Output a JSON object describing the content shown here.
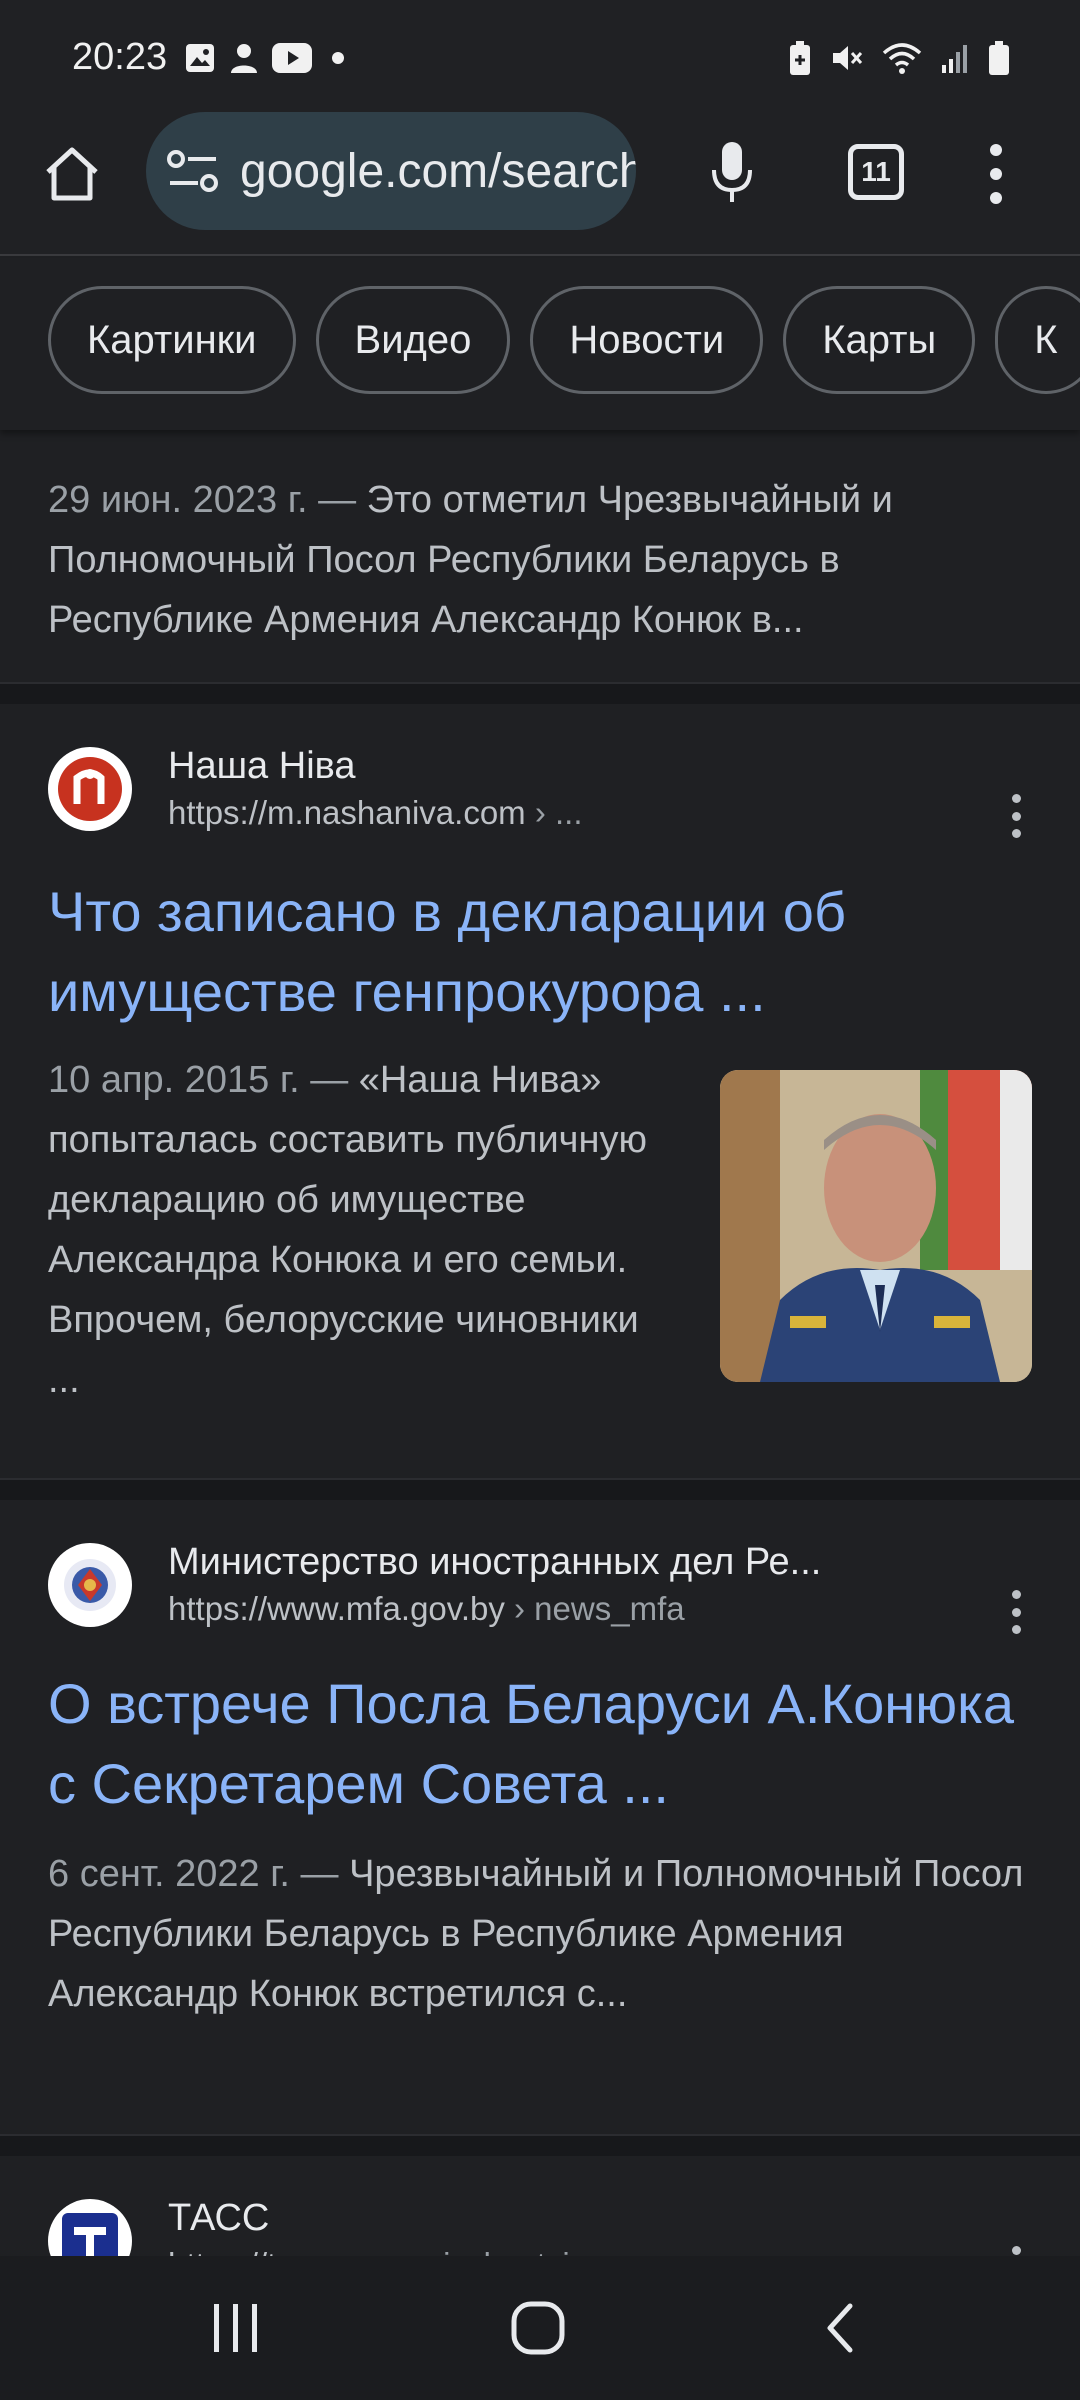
{
  "status_bar": {
    "time": "20:23",
    "left_icons": [
      "gallery-icon",
      "person-icon",
      "youtube-icon",
      "dot-icon"
    ],
    "right_icons": [
      "battery-saver-icon",
      "mute-icon",
      "wifi-icon",
      "signal-icon",
      "battery-icon"
    ]
  },
  "toolbar": {
    "url": "google.com/search",
    "tab_count": "11"
  },
  "chips": [
    "Картинки",
    "Видео",
    "Новости",
    "Карты",
    "К"
  ],
  "results": {
    "first_snippet": {
      "date": "29 июн. 2023 г. — ",
      "text": "Это отметил Чрезвычайный и Полномочный Посол Республики Беларусь в Республике Армения Александр Конюк в..."
    },
    "items": [
      {
        "source": "Наша Ніва",
        "url": "https://m.nashaniva.com",
        "path": " › ...",
        "title": "Что записано в декларации об имуществе генпрокурора ...",
        "date": "10 апр. 2015 г. — ",
        "snippet": "«Наша Нива» попыталась составить публичную декларацию об имуществе Александра Конюка и его семьи. Впрочем, белорусские чиновники ..."
      },
      {
        "source": "Министерство иностранных дел Ре...",
        "url": "https://www.mfa.gov.by",
        "path": " › news_mfa",
        "title": "О встрече Посла Беларуси А.Конюка с Секретарем Совета ...",
        "date": "6 сент. 2022 г. — ",
        "snippet": "Чрезвычайный и Полномочный Посол Республики Беларусь в Республике Армения Александр Конюк встретился с..."
      },
      {
        "source": "ТАСС",
        "url": "https://tass.ru",
        "path": " › proisshestviya"
      }
    ]
  },
  "colors": {
    "background": "#1f2023",
    "link": "#8ab4f8",
    "omnibox": "#2f3f48"
  }
}
